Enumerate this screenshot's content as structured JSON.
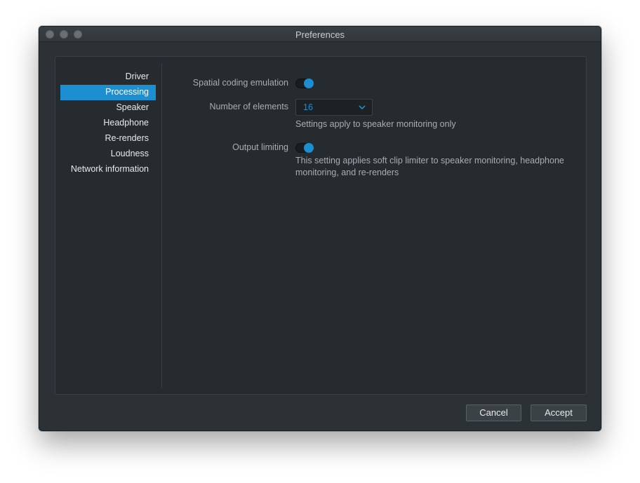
{
  "window": {
    "title": "Preferences"
  },
  "sidebar": {
    "items": [
      {
        "label": "Driver"
      },
      {
        "label": "Processing"
      },
      {
        "label": "Speaker"
      },
      {
        "label": "Headphone"
      },
      {
        "label": "Re-renders"
      },
      {
        "label": "Loudness"
      },
      {
        "label": "Network information"
      }
    ],
    "active": "Processing"
  },
  "settings": {
    "spatial_coding": {
      "label": "Spatial coding emulation",
      "enabled": true
    },
    "num_elements": {
      "label": "Number of elements",
      "value": "16",
      "note": "Settings apply to speaker monitoring only"
    },
    "output_limiting": {
      "label": "Output limiting",
      "enabled": true,
      "note": "This setting applies soft clip limiter to speaker monitoring, headphone monitoring, and re-renders"
    }
  },
  "buttons": {
    "cancel": "Cancel",
    "accept": "Accept"
  },
  "colors": {
    "accent": "#1b8fd0",
    "background": "#2c3135",
    "panel": "#262b2f"
  },
  "icons": {
    "close": "close-dot-icon",
    "minimize": "minimize-dot-icon",
    "maximize": "maximize-dot-icon",
    "dropdown": "chevron-down-icon"
  }
}
